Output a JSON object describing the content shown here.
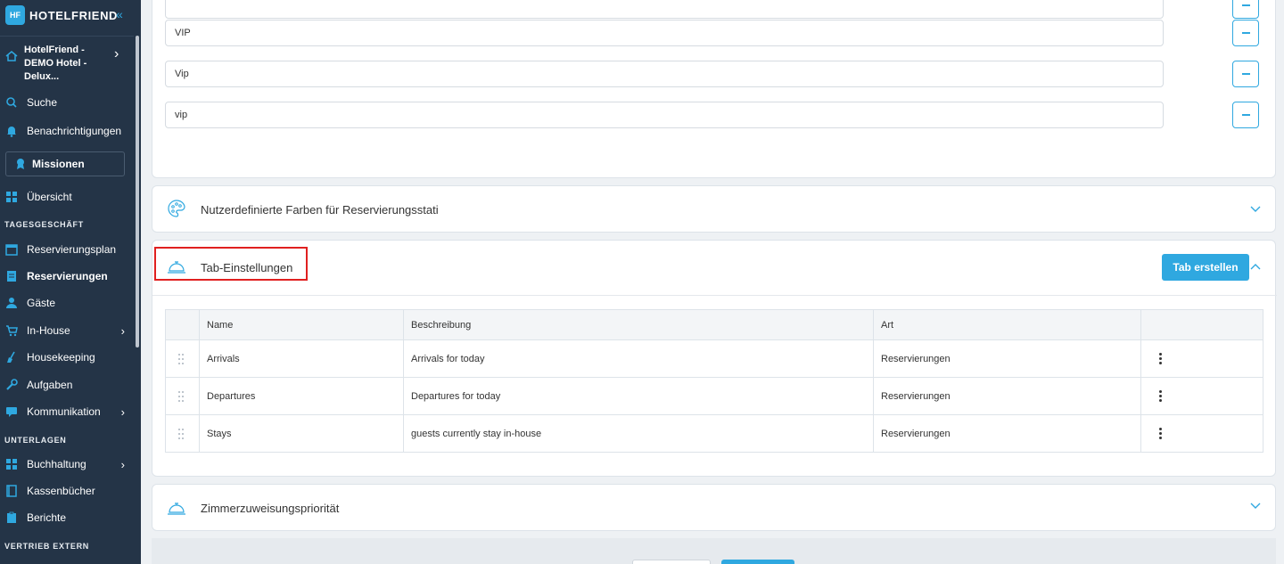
{
  "brand": {
    "name": "HOTELFRIEND",
    "mark": "HF"
  },
  "hotel": {
    "name": "HotelFriend - DEMO Hotel - Delux..."
  },
  "sidebar": {
    "search": "Suche",
    "notifications": "Benachrichtigungen",
    "missions": "Missionen",
    "overview": "Übersicht",
    "section_daily": "TAGESGESCHÄFT",
    "reservation_plan": "Reservierungsplan",
    "reservations": "Reservierungen",
    "guests": "Gäste",
    "inhouse": "In-House",
    "housekeeping": "Housekeeping",
    "tasks": "Aufgaben",
    "communication": "Kommunikation",
    "section_docs": "UNTERLAGEN",
    "accounting": "Buchhaltung",
    "cashbooks": "Kassenbücher",
    "reports": "Berichte",
    "section_sales": "VERTRIEB EXTERN"
  },
  "tags": [
    "VIP",
    "Vip",
    "vip"
  ],
  "sections": {
    "colors_title": "Nutzerdefinierte Farben für Reservierungsstati",
    "tabs_title": "Tab-Einstellungen",
    "tabs_create": "Tab erstellen",
    "room_priority_title": "Zimmerzuweisungspriorität"
  },
  "table": {
    "headers": {
      "name": "Name",
      "description": "Beschreibung",
      "type": "Art"
    },
    "rows": [
      {
        "name": "Arrivals",
        "description": "Arrivals for today",
        "type": "Reservierungen"
      },
      {
        "name": "Departures",
        "description": "Departures for today",
        "type": "Reservierungen"
      },
      {
        "name": "Stays",
        "description": "guests currently stay in-house",
        "type": "Reservierungen"
      }
    ]
  },
  "colors": {
    "accent": "#2fa8e0",
    "sidebar": "#243447",
    "highlight": "#e02020"
  }
}
